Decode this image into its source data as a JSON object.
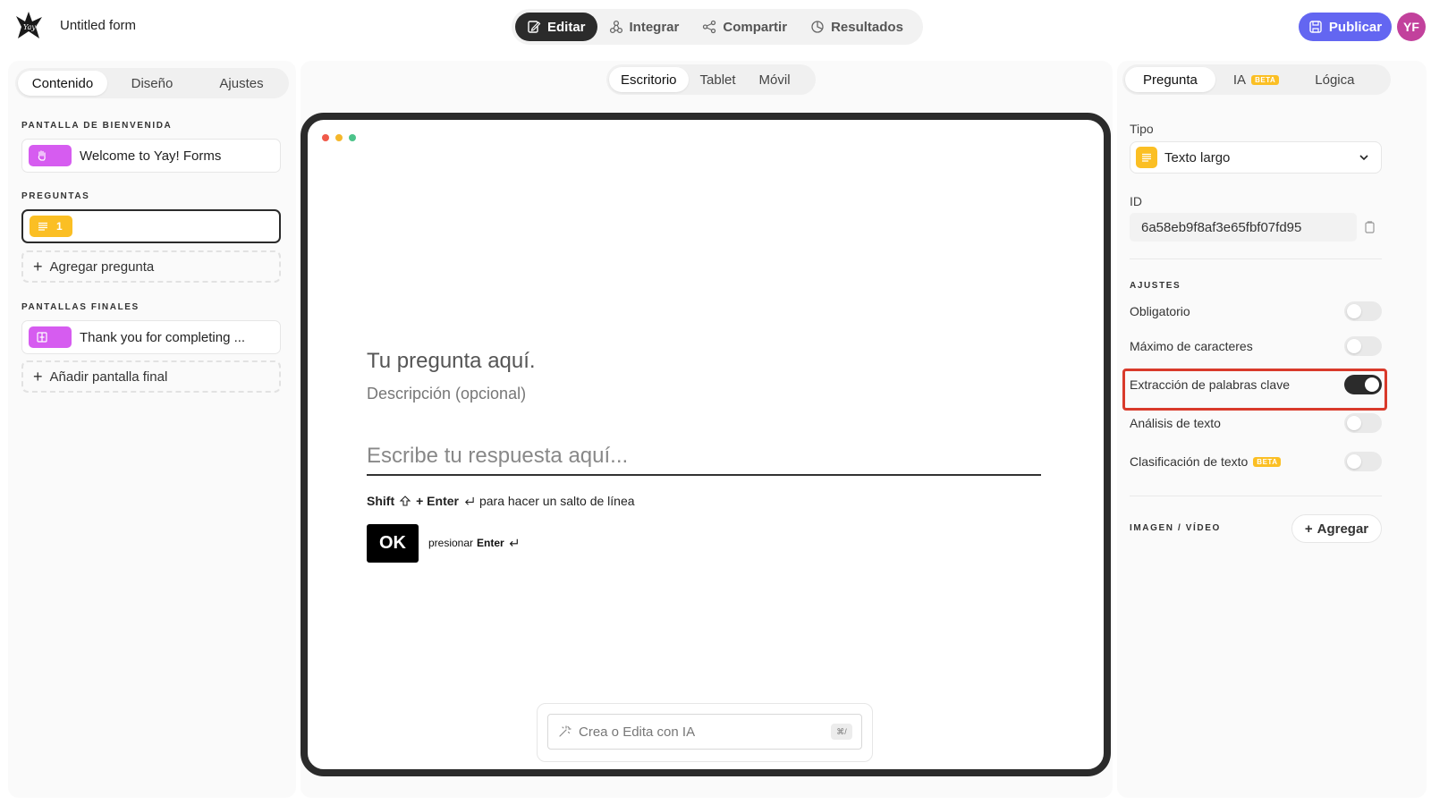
{
  "header": {
    "form_title": "Untitled form",
    "tabs": [
      {
        "label": "Editar",
        "icon": "edit-icon",
        "active": true
      },
      {
        "label": "Integrar",
        "icon": "integrate-icon",
        "active": false
      },
      {
        "label": "Compartir",
        "icon": "share-icon",
        "active": false
      },
      {
        "label": "Resultados",
        "icon": "results-icon",
        "active": false
      }
    ],
    "publish_label": "Publicar",
    "avatar_initials": "YF"
  },
  "left": {
    "tabs": [
      "Contenido",
      "Diseño",
      "Ajustes"
    ],
    "active_tab": "Contenido",
    "welcome_heading": "PANTALLA DE BIENVENIDA",
    "welcome_card": "Welcome to Yay! Forms",
    "questions_heading": "PREGUNTAS",
    "question_number": "1",
    "add_question": "Agregar pregunta",
    "endings_heading": "PANTALLAS FINALES",
    "ending_card": "Thank you for completing ...",
    "add_ending": "Añadir pantalla final"
  },
  "center": {
    "device_tabs": [
      "Escritorio",
      "Tablet",
      "Móvil"
    ],
    "active_device": "Escritorio",
    "question_placeholder": "Tu pregunta aquí.",
    "description_placeholder": "Descripción (opcional)",
    "answer_placeholder": "Escribe tu respuesta aquí...",
    "hint_shift": "Shift",
    "hint_enter": "+ Enter",
    "hint_text": "para hacer un salto de línea",
    "ok_label": "OK",
    "press_label": "presionar",
    "press_key": "Enter",
    "ai_placeholder": "Crea o Edita con IA",
    "ai_shortcut": "⌘/"
  },
  "right": {
    "tabs": [
      "Pregunta",
      "IA",
      "Lógica"
    ],
    "active_tab": "Pregunta",
    "beta_label": "BETA",
    "type_label": "Tipo",
    "type_value": "Texto largo",
    "id_label": "ID",
    "id_value": "6a58eb9f8af3e65fbf07fd95",
    "settings_heading": "AJUSTES",
    "settings": [
      {
        "label": "Obligatorio",
        "on": false
      },
      {
        "label": "Máximo de caracteres",
        "on": false
      },
      {
        "label": "Extracción de palabras clave",
        "on": true
      },
      {
        "label": "Análisis de texto",
        "on": false
      },
      {
        "label": "Clasificación de texto",
        "on": false,
        "beta": true
      }
    ],
    "media_heading": "IMAGEN / VÍDEO",
    "add_media": "Agregar"
  },
  "colors": {
    "accent": "#6366f1",
    "avatar": "#c2419c",
    "welcome_chip": "#d65cf0",
    "question_chip": "#fbbf24",
    "ending_chip": "#d65cf0",
    "highlight": "#d93a2b",
    "dot_red": "#f05a4a",
    "dot_yellow": "#f5b72b",
    "dot_green": "#4cc38a"
  }
}
